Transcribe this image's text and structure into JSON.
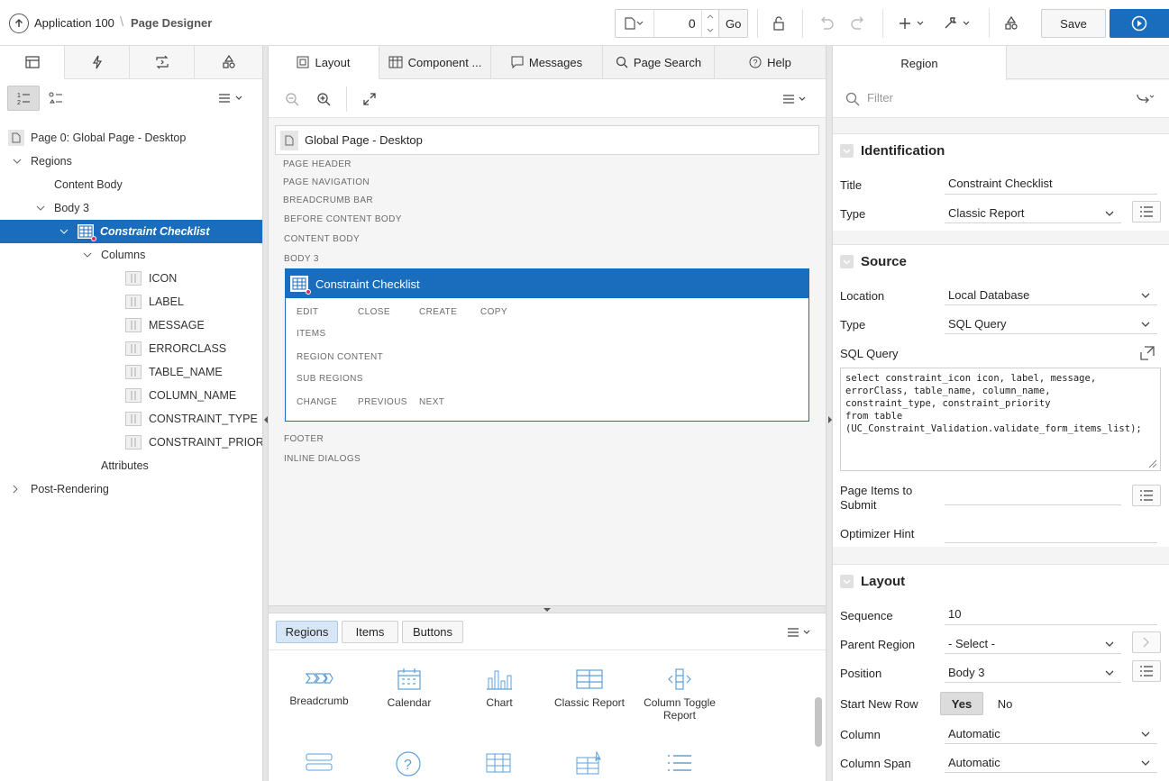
{
  "topbar": {
    "app_name": "Application 100",
    "page_designer": "Page Designer",
    "page_number": "0",
    "go_label": "Go",
    "save_label": "Save",
    "accent": "#1a6dbd"
  },
  "left": {
    "tree": {
      "page": "Page 0: Global Page - Desktop",
      "regions": "Regions",
      "content_body": "Content Body",
      "body3": "Body 3",
      "selected_region": "Constraint Checklist",
      "columns": "Columns",
      "column_items": [
        "ICON",
        "LABEL",
        "MESSAGE",
        "ERRORCLASS",
        "TABLE_NAME",
        "COLUMN_NAME",
        "CONSTRAINT_TYPE",
        "CONSTRAINT_PRIORIT"
      ],
      "attributes": "Attributes",
      "post_rendering": "Post-Rendering"
    }
  },
  "center": {
    "tabs": [
      "Layout",
      "Component ...",
      "Messages",
      "Page Search",
      "Help"
    ],
    "page_title": "Global Page - Desktop",
    "positions": [
      "PAGE HEADER",
      "PAGE NAVIGATION",
      "BREADCRUMB BAR",
      "BEFORE CONTENT BODY",
      "CONTENT BODY",
      "BODY 3"
    ],
    "region": {
      "title": "Constraint Checklist",
      "row1": [
        "EDIT",
        "CLOSE",
        "CREATE",
        "COPY"
      ],
      "items": "ITEMS",
      "region_content": "REGION CONTENT",
      "sub_regions": "SUB REGIONS",
      "row2": [
        "CHANGE",
        "PREVIOUS",
        "NEXT"
      ]
    },
    "footer": "FOOTER",
    "inline_dialogs": "INLINE DIALOGS",
    "gallery": {
      "tabs": [
        "Regions",
        "Items",
        "Buttons"
      ],
      "items": [
        {
          "label": "Breadcrumb",
          "icon": "breadcrumb-icon"
        },
        {
          "label": "Calendar",
          "icon": "calendar-icon"
        },
        {
          "label": "Chart",
          "icon": "chart-icon"
        },
        {
          "label": "Classic Report",
          "icon": "classic-report-icon"
        },
        {
          "label": "Column Toggle Report",
          "icon": "column-toggle-icon"
        }
      ]
    }
  },
  "right": {
    "tab": "Region",
    "filter_placeholder": "Filter",
    "identification": {
      "header": "Identification",
      "title_label": "Title",
      "title_value": "Constraint Checklist",
      "type_label": "Type",
      "type_value": "Classic Report"
    },
    "source": {
      "header": "Source",
      "location_label": "Location",
      "location_value": "Local Database",
      "type_label": "Type",
      "type_value": "SQL Query",
      "sql_label": "SQL Query",
      "sql_value": "select constraint_icon icon, label, message,\nerrorClass, table_name, column_name,\nconstraint_type, constraint_priority\nfrom table\n(UC_Constraint_Validation.validate_form_items_list);",
      "items_submit_label": "Page Items to Submit",
      "optimizer_label": "Optimizer Hint"
    },
    "layout": {
      "header": "Layout",
      "sequence_label": "Sequence",
      "sequence_value": "10",
      "parent_label": "Parent Region",
      "parent_value": "- Select -",
      "position_label": "Position",
      "position_value": "Body 3",
      "start_row_label": "Start New Row",
      "yes": "Yes",
      "no": "No",
      "column_label": "Column",
      "column_value": "Automatic",
      "span_label": "Column Span",
      "span_value": "Automatic"
    }
  }
}
